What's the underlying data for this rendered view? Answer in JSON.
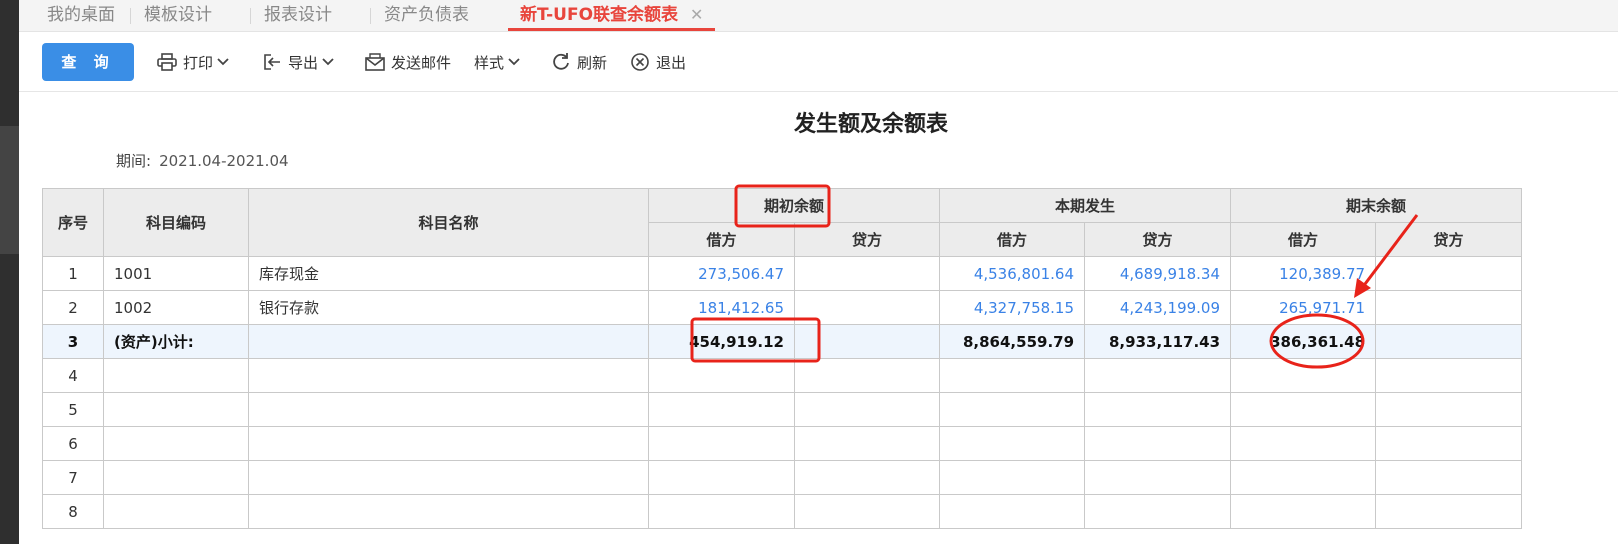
{
  "tabs": [
    {
      "label": "我的桌面"
    },
    {
      "label": "模板设计"
    },
    {
      "label": "报表设计"
    },
    {
      "label": "资产负债表"
    },
    {
      "label": "新T-UFO联查余额表",
      "active": true,
      "close": "✕"
    }
  ],
  "toolbar": {
    "query_label": "查 询",
    "print_label": "打印",
    "export_label": "导出",
    "email_label": "发送邮件",
    "style_label": "样式",
    "refresh_label": "刷新",
    "exit_label": "退出"
  },
  "report": {
    "title": "发生额及余额表",
    "period_label": "期间:",
    "period_value": "2021.04-2021.04"
  },
  "table": {
    "headers": {
      "seq": "序号",
      "code": "科目编码",
      "name": "科目名称",
      "opening": "期初余额",
      "current": "本期发生",
      "closing": "期末余额",
      "debit": "借方",
      "credit": "贷方"
    },
    "rows": [
      {
        "seq": "1",
        "code": "1001",
        "name": "库存现金",
        "open_debit": "273,506.47",
        "open_credit": "",
        "cur_debit": "4,536,801.64",
        "cur_credit": "4,689,918.34",
        "close_debit": "120,389.77",
        "close_credit": ""
      },
      {
        "seq": "2",
        "code": "1002",
        "name": "银行存款",
        "open_debit": "181,412.65",
        "open_credit": "",
        "cur_debit": "4,327,758.15",
        "cur_credit": "4,243,199.09",
        "close_debit": "265,971.71",
        "close_credit": ""
      },
      {
        "seq": "3",
        "code": "(资产)小计:",
        "name": "",
        "open_debit": "454,919.12",
        "open_credit": "",
        "cur_debit": "8,864,559.79",
        "cur_credit": "8,933,117.43",
        "close_debit": "386,361.48",
        "close_credit": ""
      },
      {
        "seq": "4"
      },
      {
        "seq": "5"
      },
      {
        "seq": "6"
      },
      {
        "seq": "7"
      },
      {
        "seq": "8"
      }
    ]
  },
  "colors": {
    "accent": "#3a8ee6",
    "active_tab": "#e8453c",
    "annotation": "#e8231a",
    "link_number": "#3a82e6"
  }
}
